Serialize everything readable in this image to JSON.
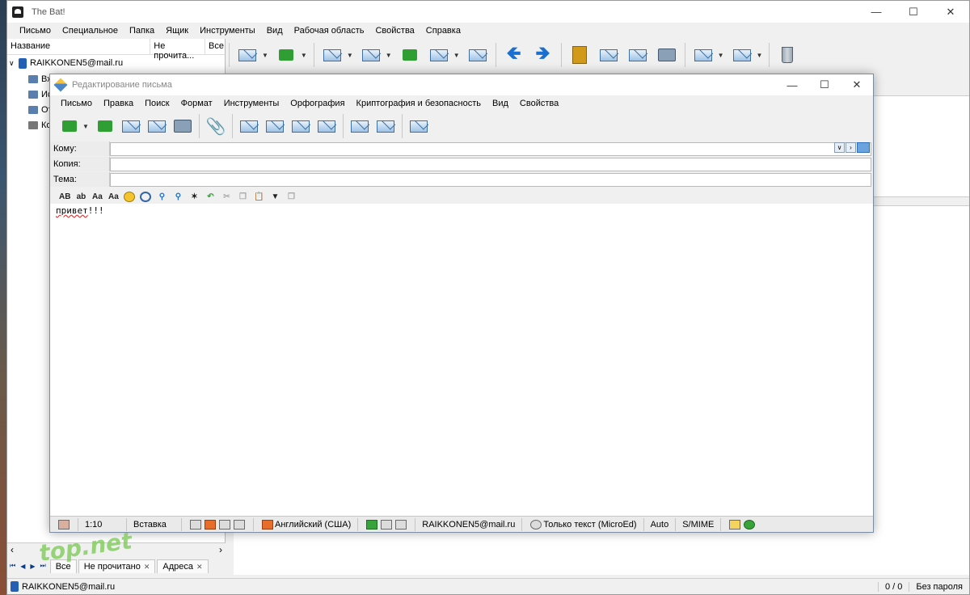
{
  "main_window": {
    "title": "The Bat!",
    "menu": [
      "Письмо",
      "Специальное",
      "Папка",
      "Ящик",
      "Инструменты",
      "Вид",
      "Рабочая область",
      "Свойства",
      "Справка"
    ]
  },
  "folder_pane": {
    "columns": [
      "Название",
      "Не прочита...",
      "Все"
    ],
    "account": "RAIKKONEN5@mail.ru",
    "folders": [
      "Вх",
      "Ис",
      "От",
      "Ко"
    ]
  },
  "bottom_tabs": {
    "tabs": [
      "Все",
      "Не прочитано",
      "Адреса"
    ]
  },
  "main_status": {
    "account": "RAIKKONEN5@mail.ru",
    "counter": "0 / 0",
    "password": "Без пароля"
  },
  "editor": {
    "title": "Редактирование письма",
    "menu": [
      "Письмо",
      "Правка",
      "Поиск",
      "Формат",
      "Инструменты",
      "Орфография",
      "Криптография и безопасность",
      "Вид",
      "Свойства"
    ],
    "fields": {
      "to_label": "Кому:",
      "to_value": "",
      "cc_label": "Копия:",
      "cc_value": "",
      "subject_label": "Тема:",
      "subject_value": ""
    },
    "format_toolbar": [
      "AB",
      "ab",
      "Aa",
      "Aa"
    ],
    "body_word": "привет",
    "body_rest": "!!!",
    "status": {
      "position": "1:10",
      "mode": "Вставка",
      "language": "Английский (США)",
      "account": "RAIKKONEN5@mail.ru",
      "format": "Только текст (MicroEd)",
      "encoding": "Auto",
      "security": "S/MIME"
    }
  },
  "watermark": "top.net"
}
